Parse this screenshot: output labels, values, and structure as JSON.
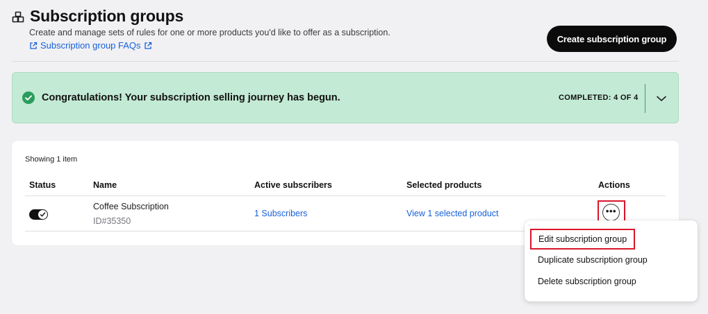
{
  "header": {
    "title": "Subscription groups",
    "subtitle": "Create and manage sets of rules for one or more products you'd like to offer as a subscription.",
    "faq_link": "Subscription group FAQs",
    "create_button": "Create subscription group",
    "icon": "cube-group-icon"
  },
  "banner": {
    "message": "Congratulations! Your subscription selling journey has begun.",
    "progress_text": "COMPLETED: 4 OF 4",
    "progress": {
      "completed": 4,
      "total": 4
    },
    "icon": "check-circle-icon",
    "expand_icon": "chevron-down-icon",
    "color": "#c3ead4"
  },
  "table": {
    "showing": "Showing 1 item",
    "columns": [
      "Status",
      "Name",
      "Active subscribers",
      "Selected products",
      "Actions"
    ],
    "rows": [
      {
        "status_enabled": true,
        "name": "Coffee Subscription",
        "id": "ID#35350",
        "subscribers": "1 Subscribers",
        "products": "View 1 selected product",
        "actions_label": "•••"
      }
    ]
  },
  "actions_menu": {
    "items": [
      "Edit subscription group",
      "Duplicate subscription group",
      "Delete subscription group"
    ]
  },
  "colors": {
    "accent_link": "#1760d9",
    "highlight": "#d9142a",
    "primary_button": "#0b0b0c",
    "success": "#2a9d5c"
  }
}
